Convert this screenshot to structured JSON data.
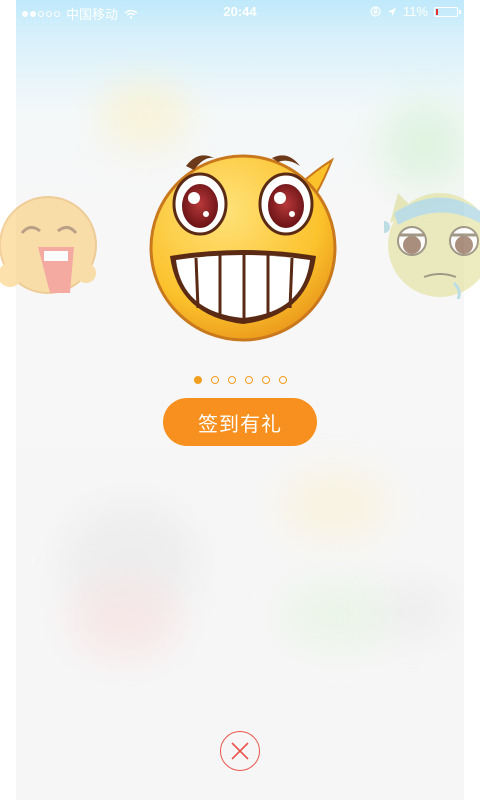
{
  "status_bar": {
    "carrier": "中国移动",
    "time": "20:44",
    "battery": "11%",
    "battery_level": 0.11,
    "signal_bars_filled": 2,
    "signal_bars_total": 5
  },
  "carousel": {
    "pages_total": 6,
    "active_page": 1,
    "center_icon": "grinning-face-icon",
    "left_icon": "crying-face-icon",
    "right_icon": "sick-face-icon"
  },
  "signin_button": {
    "label": "签到有礼"
  },
  "close": {
    "icon": "close-icon"
  },
  "colors": {
    "accent": "#f7901e",
    "close": "#e8574f",
    "status_bar_bg": "#bfe9fb"
  }
}
